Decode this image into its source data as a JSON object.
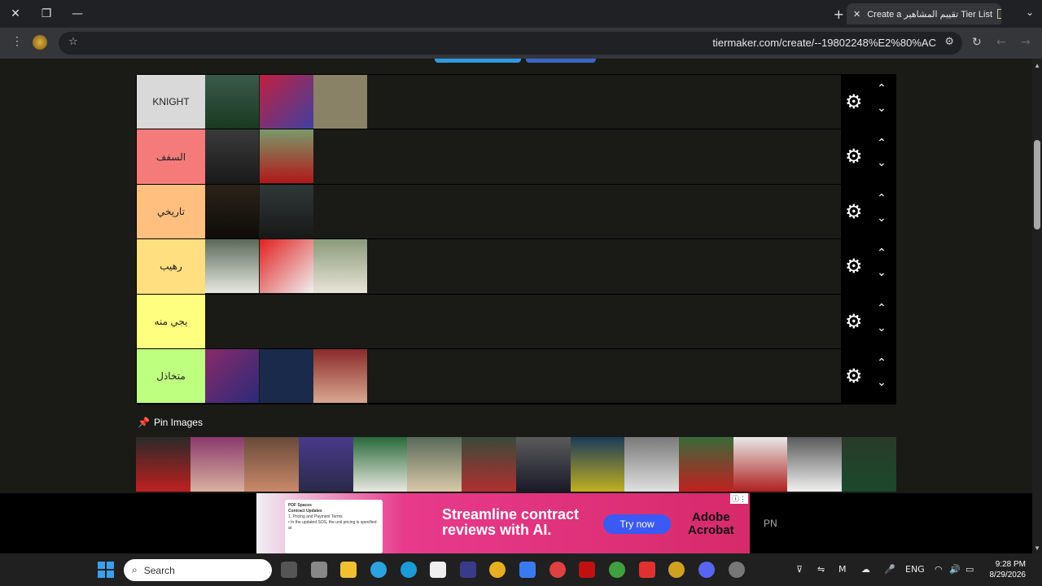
{
  "window": {
    "close_glyph": "✕",
    "restore_glyph": "❐",
    "minimize_glyph": "—"
  },
  "tab": {
    "title": "Create a تقييم المشاهير Tier List",
    "close_glyph": "✕",
    "newtab_glyph": "+",
    "list_glyph": "⌄"
  },
  "address": {
    "url": "tiermaker.com/create/--19802248%E2%80%AC",
    "menu_glyph": "⋮",
    "star_glyph": "☆",
    "tune_glyph": "⚙",
    "reload_glyph": "↻",
    "back_glyph": "←",
    "forward_glyph": "→"
  },
  "tiers": [
    {
      "label": "KNIGHT",
      "color": "#d9d9d9",
      "items": [
        "player-stadium",
        "player-red-jersey",
        "falcons-logo"
      ]
    },
    {
      "label": "السفف",
      "color": "#f57b7b",
      "items": [
        "man-mustache",
        "man-red-scarf"
      ]
    },
    {
      "label": "تاريخي",
      "color": "#ffbf7f",
      "items": [
        "man-sunglasses",
        "man-studio"
      ]
    },
    {
      "label": "رهيب",
      "color": "#ffdf7f",
      "items": [
        "man-saluting",
        "level-up-duo",
        "man-ghutra"
      ]
    },
    {
      "label": "يجي منه",
      "color": "#ffff7f",
      "items": []
    },
    {
      "label": "متخاذل",
      "color": "#bfff7f",
      "items": [
        "boy-neon",
        "mt3b-logo",
        "streamer-headset"
      ]
    }
  ],
  "controls": {
    "gear_glyph": "⚙",
    "up_glyph": "⌃",
    "down_glyph": "⌄"
  },
  "pin": {
    "label": "Pin Images",
    "icon_glyph": "📌"
  },
  "pool_items": [
    "streamer-red-chair",
    "streamer-headphones",
    "streamer-wide-eyes",
    "streamer-purple",
    "falcon-ghutra",
    "man-saluting-2",
    "man-shemagh",
    "man-thobe",
    "athlete-green",
    "man-selfie",
    "man-saluting-3",
    "man-red-shemagh",
    "man-white-thobe",
    "man-falcon"
  ],
  "ad": {
    "headline_1": "Streamline contract",
    "headline_2": "reviews with AI.",
    "cta": "Try now",
    "brand_1": "Adobe",
    "brand_2": "Acrobat",
    "doc_title": "PDF Spaces",
    "doc_l1": "Contract Updates",
    "doc_l2": "1. Pricing and Payment Terms",
    "doc_l3": "• In the updated SOS, the unit pricing is specified at",
    "side_text": "PN"
  },
  "taskbar": {
    "search_placeholder": "Search",
    "search_icon_glyph": "⌕",
    "lang": "ENG",
    "time": "9:28 PM",
    "date": "8/29/2026"
  }
}
